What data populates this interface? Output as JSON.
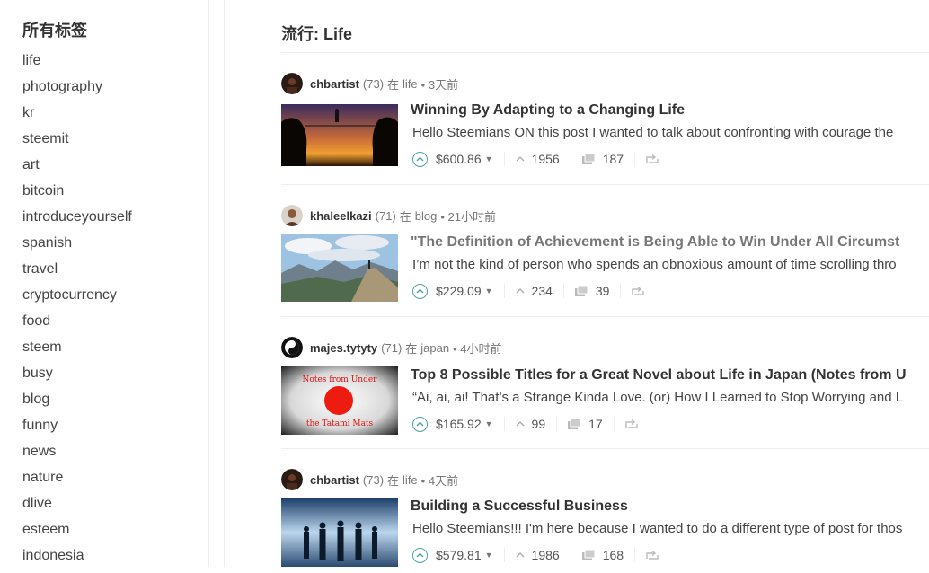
{
  "sidebar": {
    "title": "所有标签",
    "tags": [
      "life",
      "photography",
      "kr",
      "steemit",
      "art",
      "bitcoin",
      "introduceyourself",
      "spanish",
      "travel",
      "cryptocurrency",
      "food",
      "steem",
      "busy",
      "blog",
      "funny",
      "news",
      "nature",
      "dlive",
      "esteem",
      "indonesia"
    ]
  },
  "page": {
    "title": "流行: Life"
  },
  "posts": [
    {
      "author": "chbartist",
      "rep": "(73)",
      "in_word": "在",
      "category": "life",
      "time": "• 3天前",
      "title": "Winning By Adapting to a Changing Life",
      "excerpt": "Hello Steemians ON this post I wanted to talk about confronting with courage the",
      "payout": "$600.86",
      "votes": "1956",
      "comments": "187",
      "thumb": "sunset-tightrope",
      "visited": false
    },
    {
      "author": "khaleelkazi",
      "rep": "(71)",
      "in_word": "在",
      "category": "blog",
      "time": "• 21小时前",
      "title": "\"The Definition of Achievement is Being Able to Win Under All Circumst",
      "excerpt": "I’m not the kind of person who spends an obnoxious amount of time scrolling thro",
      "payout": "$229.09",
      "votes": "234",
      "comments": "39",
      "thumb": "mountain-summit",
      "visited": true
    },
    {
      "author": "majes.tytyty",
      "rep": "(71)",
      "in_word": "在",
      "category": "japan",
      "time": "• 4小时前",
      "title": "Top 8 Possible Titles for a Great Novel about Life in Japan (Notes from U",
      "excerpt": "“Ai, ai, ai! That’s a Strange Kinda Love. (or) How I Learned to Stop Worrying and L",
      "payout": "$165.92",
      "votes": "99",
      "comments": "17",
      "thumb": "rising-sun-notes",
      "visited": false,
      "thumb_text_top": "Notes from Under",
      "thumb_text_bottom": "the Tatami Mats"
    },
    {
      "author": "chbartist",
      "rep": "(73)",
      "in_word": "在",
      "category": "life",
      "time": "• 4天前",
      "title": "Building a Successful Business",
      "excerpt": "Hello Steemians!!! I'm here because I wanted to do a different type of post for thos",
      "payout": "$579.81",
      "votes": "1986",
      "comments": "168",
      "thumb": "business-silhouettes",
      "visited": false
    }
  ],
  "colors": {
    "vote_accent": "#4ba2a0",
    "divider": "#eeeeee"
  },
  "icons": {
    "vote": "upvote-circle-icon",
    "payout_menu": "caret-down-icon",
    "voters": "chevron-up-icon",
    "comments": "comments-icon",
    "reblog": "reblog-icon"
  }
}
